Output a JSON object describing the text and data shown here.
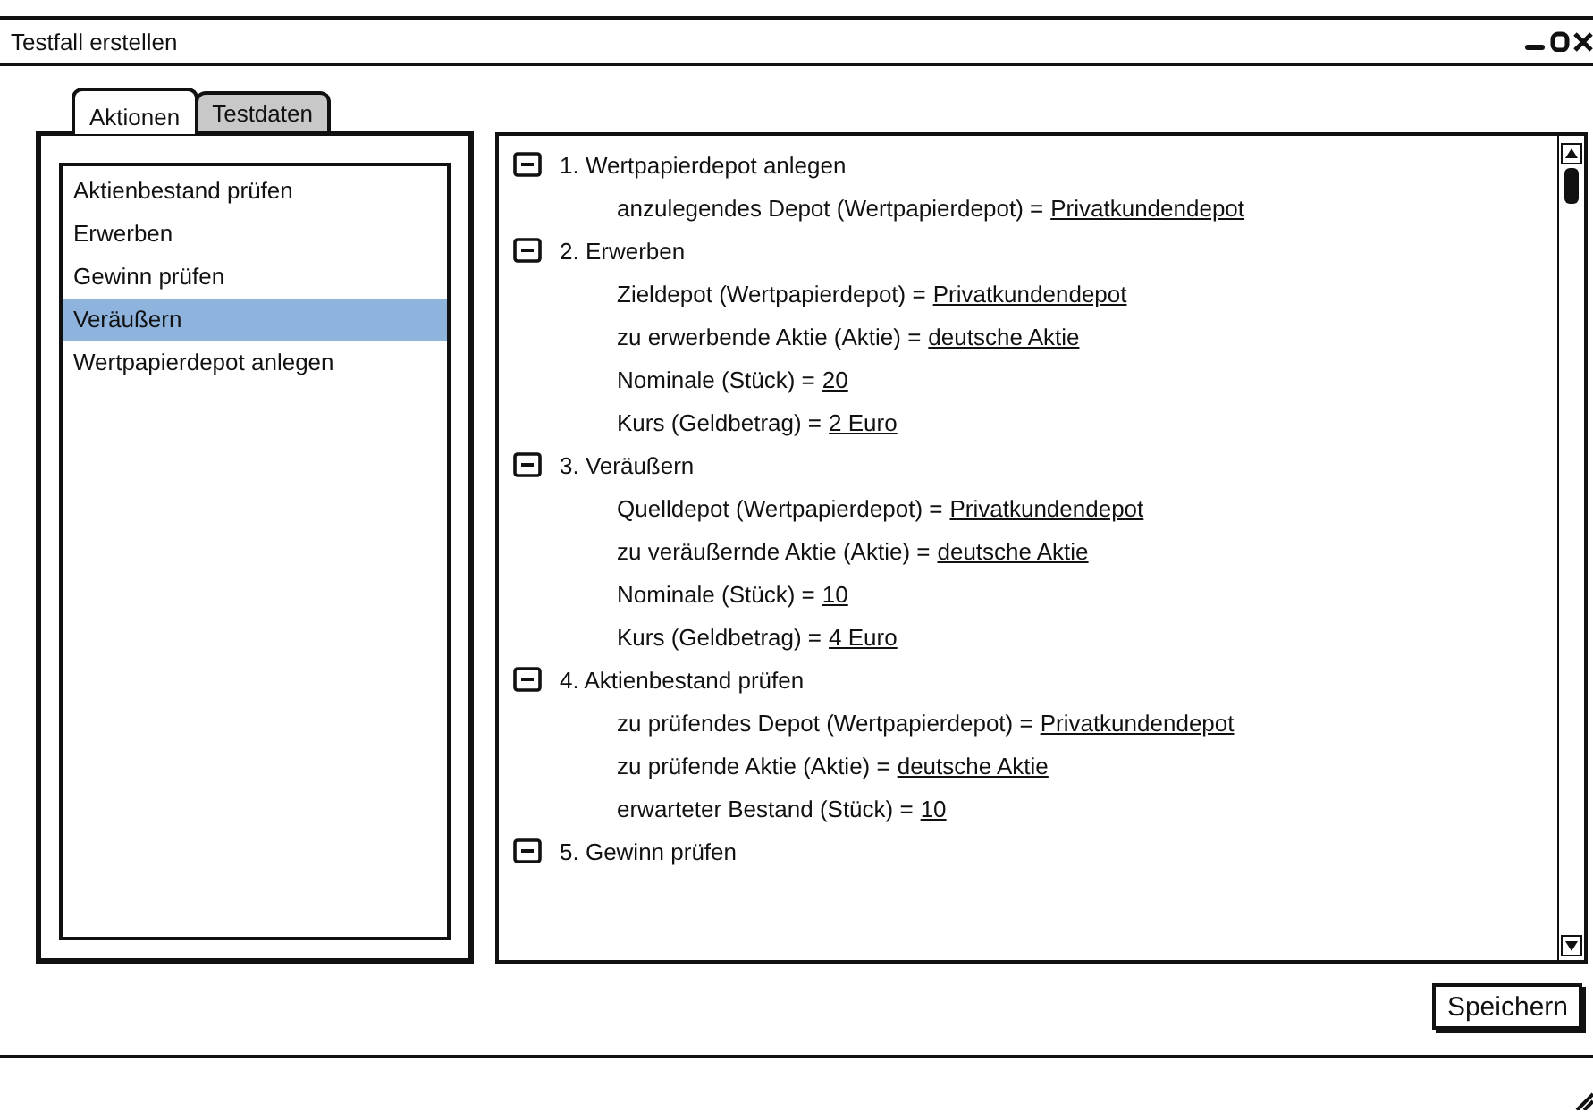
{
  "window": {
    "title": "Testfall erstellen"
  },
  "tabs": [
    {
      "label": "Aktionen",
      "selected": true
    },
    {
      "label": "Testdaten",
      "selected": false
    }
  ],
  "actions": [
    {
      "label": "Aktienbestand prüfen",
      "selected": false
    },
    {
      "label": "Erwerben",
      "selected": false
    },
    {
      "label": "Gewinn prüfen",
      "selected": false
    },
    {
      "label": "Veräußern",
      "selected": true
    },
    {
      "label": "Wertpapierdepot anlegen",
      "selected": false
    }
  ],
  "steps": [
    {
      "label": "1. Wertpapierdepot anlegen",
      "expanded": true,
      "children": [
        {
          "label": "anzulegendes Depot (Wertpapierdepot) =",
          "value": "Privatkundendepot"
        }
      ]
    },
    {
      "label": "2. Erwerben",
      "expanded": true,
      "children": [
        {
          "label": "Zieldepot (Wertpapierdepot) =",
          "value": "Privatkundendepot"
        },
        {
          "label": "zu erwerbende Aktie (Aktie) =",
          "value": "deutsche Aktie"
        },
        {
          "label": "Nominale (Stück) =",
          "value": "20"
        },
        {
          "label": "Kurs (Geldbetrag) =",
          "value": "2 Euro"
        }
      ]
    },
    {
      "label": "3. Veräußern",
      "expanded": true,
      "children": [
        {
          "label": "Quelldepot (Wertpapierdepot) =",
          "value": "Privatkundendepot"
        },
        {
          "label": "zu veräußernde Aktie (Aktie) =",
          "value": "deutsche Aktie"
        },
        {
          "label": "Nominale (Stück) =",
          "value": "10"
        },
        {
          "label": "Kurs (Geldbetrag) =",
          "value": "4 Euro"
        }
      ]
    },
    {
      "label": "4. Aktienbestand prüfen",
      "expanded": true,
      "children": [
        {
          "label": "zu prüfendes Depot (Wertpapierdepot) =",
          "value": "Privatkundendepot"
        },
        {
          "label": "zu prüfende Aktie (Aktie) =",
          "value": "deutsche Aktie"
        },
        {
          "label": "erwarteter Bestand (Stück) =",
          "value": "10"
        }
      ]
    },
    {
      "label": "5. Gewinn prüfen",
      "expanded": true
    }
  ],
  "buttons": [
    "Speichern"
  ]
}
